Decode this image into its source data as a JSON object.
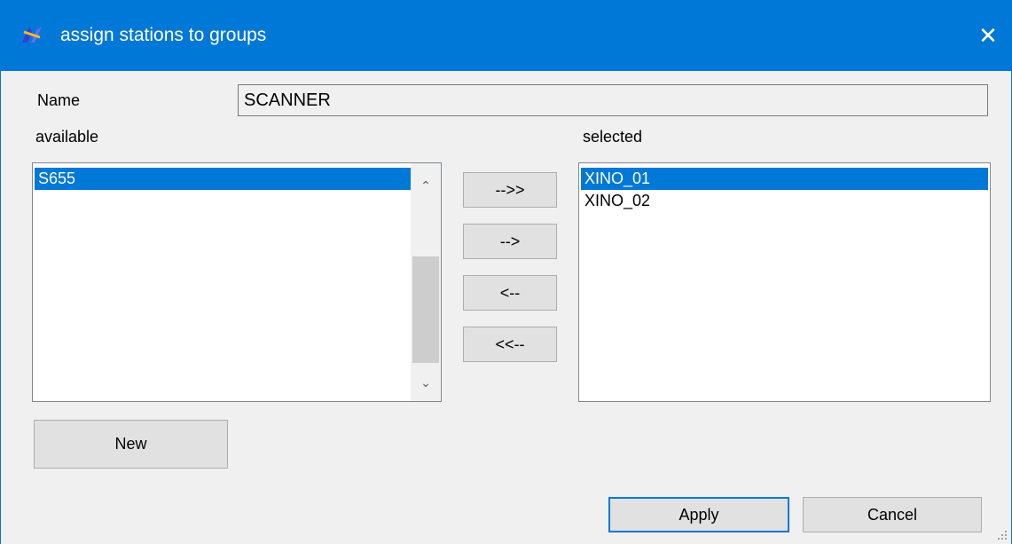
{
  "window": {
    "title": "assign stations to groups",
    "close_glyph": "✕",
    "accent_color": "#0078d7"
  },
  "form": {
    "name_label": "Name",
    "name_value": "SCANNER",
    "available_label": "available",
    "selected_label": "selected"
  },
  "available": {
    "items": [
      {
        "label": "S655",
        "selected": true
      }
    ],
    "scroll_up_glyph": "⌃",
    "scroll_down_glyph": "⌄"
  },
  "selected": {
    "items": [
      {
        "label": "XINO_01",
        "selected": true
      },
      {
        "label": "XINO_02",
        "selected": false
      }
    ]
  },
  "transfer": {
    "add_all_label": "-->>",
    "add_label": "-->",
    "remove_label": "<--",
    "remove_all_label": "<<--"
  },
  "actions": {
    "new_label": "New",
    "apply_label": "Apply",
    "cancel_label": "Cancel"
  }
}
